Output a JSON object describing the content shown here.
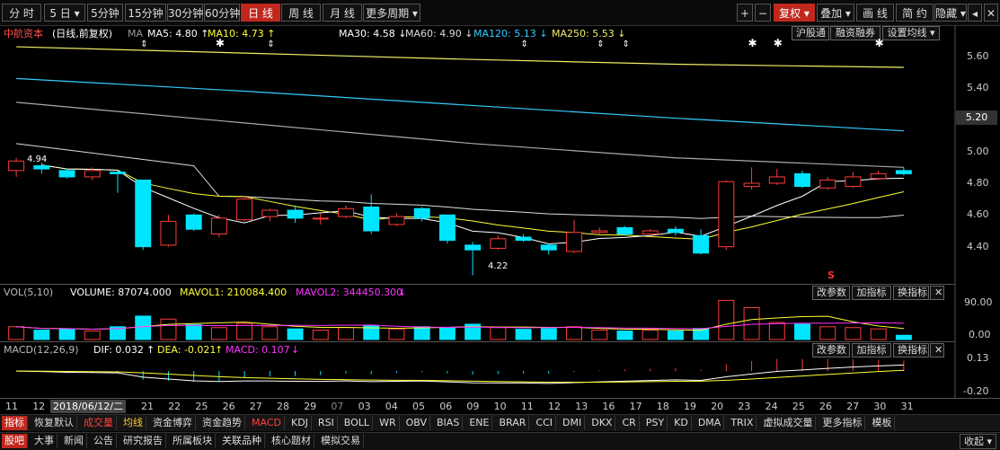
{
  "toolbar": {
    "periods": [
      {
        "label": "分 时",
        "x": 2,
        "w": 44
      },
      {
        "label": "5 日 ▾",
        "x": 49,
        "w": 46
      },
      {
        "label": "5分钟",
        "x": 97,
        "w": 40
      },
      {
        "label": "15分钟",
        "x": 139,
        "w": 46
      },
      {
        "label": "30分钟",
        "x": 186,
        "w": 40
      },
      {
        "label": "60分钟",
        "x": 227,
        "w": 40
      },
      {
        "label": "日 线",
        "x": 268,
        "w": 44,
        "active": true
      },
      {
        "label": "周 线",
        "x": 313,
        "w": 44
      },
      {
        "label": "月 线",
        "x": 359,
        "w": 44
      },
      {
        "label": "更多周期 ▾",
        "x": 404,
        "w": 64
      }
    ],
    "right": [
      {
        "label": "+",
        "x": 820,
        "w": 18
      },
      {
        "label": "−",
        "x": 840,
        "w": 18
      },
      {
        "label": "复权 ▾",
        "x": 861,
        "w": 46,
        "active": true
      },
      {
        "label": "叠加 ▾",
        "x": 909,
        "w": 42
      },
      {
        "label": "画 线",
        "x": 953,
        "w": 42
      },
      {
        "label": "简 约",
        "x": 997,
        "w": 42
      },
      {
        "label": "隐藏 ▾",
        "x": 1040,
        "w": 36
      },
      {
        "label": "◂",
        "x": 1077,
        "w": 16
      },
      {
        "label": "✕",
        "x": 1095,
        "w": 16
      }
    ]
  },
  "ma_bar": {
    "stock": "中航资本",
    "mode": "(日线,前复权)",
    "ma_label": "MA",
    "items": [
      {
        "text": "MA5: 4.80",
        "arrow": "↑",
        "color": "#ffffff",
        "x": 164
      },
      {
        "text": "MA10: 4.73",
        "arrow": "↑",
        "color": "#ffff33",
        "x": 231
      },
      {
        "text": "MA30: 4.58",
        "arrow": "↓",
        "color": "#ffffff",
        "x": 377
      },
      {
        "text": "MA60: 4.90",
        "arrow": "↓",
        "color": "#dddddd",
        "x": 451
      },
      {
        "text": "MA120: 5.13",
        "arrow": "↓",
        "color": "#33ccff",
        "x": 527
      },
      {
        "text": "MA250: 5.53",
        "arrow": "↓",
        "color": "#eeee66",
        "x": 614
      }
    ],
    "buttons": [
      {
        "label": "沪股通",
        "x": 881,
        "w": 42
      },
      {
        "label": "融资融券",
        "x": 924,
        "w": 56
      },
      {
        "label": "设置均线 ▾",
        "x": 982,
        "w": 64
      }
    ]
  },
  "price_axis": {
    "ticks": [
      "5.60",
      "5.40",
      "5.20",
      "5.00",
      "4.80",
      "4.60",
      "4.40"
    ],
    "current": "5.20",
    "max_label": "4.94",
    "min_label": "4.22",
    "s_marker": "S"
  },
  "volume_bar": {
    "label": "VOL(5,10)",
    "volume": "VOLUME: 87074.000",
    "mavol1": "MAVOL1: 210084.400",
    "mavol2": "MAVOL2: 344450.300",
    "arrow": "↓",
    "buttons": [
      "改参数",
      "加指标",
      "换指标",
      "✕"
    ],
    "ticks": [
      "90.00",
      "0.00"
    ]
  },
  "macd_bar": {
    "label": "MACD(12,26,9)",
    "dif": "DIF: 0.032",
    "dif_arrow": "↑",
    "dea": "DEA: -0.021",
    "dea_arrow": "↑",
    "macd": "MACD: 0.107",
    "macd_arrow": "↓",
    "buttons": [
      "改参数",
      "加指标",
      "换指标",
      "✕"
    ],
    "ticks": [
      "0.13",
      "-0.20"
    ]
  },
  "date_axis": {
    "dates": [
      "11",
      "12",
      "15",
      "19",
      "20",
      "21",
      "22",
      "25",
      "26",
      "27",
      "28",
      "29",
      "07",
      "03",
      "04",
      "05",
      "06",
      "09",
      "10",
      "11",
      "12",
      "13",
      "16",
      "17",
      "18",
      "19",
      "20",
      "23",
      "24",
      "25",
      "26",
      "27",
      "30",
      "31"
    ],
    "cursor_date": "2018/06/12/二"
  },
  "tabs1": [
    {
      "label": "指标",
      "style": "active"
    },
    {
      "label": "恢复默认",
      "style": ""
    },
    {
      "label": "成交量",
      "style": "red"
    },
    {
      "label": "均线",
      "style": "gold"
    },
    {
      "label": "资金博弈",
      "style": ""
    },
    {
      "label": "资金趋势",
      "style": ""
    },
    {
      "label": "MACD",
      "style": "red"
    },
    {
      "label": "KDJ",
      "style": ""
    },
    {
      "label": "RSI",
      "style": ""
    },
    {
      "label": "BOLL",
      "style": ""
    },
    {
      "label": "WR",
      "style": ""
    },
    {
      "label": "OBV",
      "style": ""
    },
    {
      "label": "BIAS",
      "style": ""
    },
    {
      "label": "ENE",
      "style": ""
    },
    {
      "label": "BRAR",
      "style": ""
    },
    {
      "label": "CCI",
      "style": ""
    },
    {
      "label": "DMI",
      "style": ""
    },
    {
      "label": "DKX",
      "style": ""
    },
    {
      "label": "CR",
      "style": ""
    },
    {
      "label": "PSY",
      "style": ""
    },
    {
      "label": "KD",
      "style": ""
    },
    {
      "label": "DMA",
      "style": ""
    },
    {
      "label": "TRIX",
      "style": ""
    },
    {
      "label": "虚拟成交量",
      "style": ""
    },
    {
      "label": "更多指标",
      "style": ""
    },
    {
      "label": "模板",
      "style": ""
    }
  ],
  "tabs2": [
    {
      "label": "股吧",
      "style": "active"
    },
    {
      "label": "大事",
      "style": ""
    },
    {
      "label": "新闻",
      "style": ""
    },
    {
      "label": "公告",
      "style": ""
    },
    {
      "label": "研究报告",
      "style": ""
    },
    {
      "label": "所属板块",
      "style": ""
    },
    {
      "label": "关联品种",
      "style": ""
    },
    {
      "label": "核心题材",
      "style": ""
    },
    {
      "label": "模拟交易",
      "style": ""
    }
  ],
  "collapse_label": "收起 ▾",
  "colors": {
    "up": "#ff3b3b",
    "down": "#00e5ff",
    "ma5": "#ffffff",
    "ma10": "#ffff33",
    "ma30": "#dddddd",
    "ma120": "#33ccff",
    "ma250": "#eeee66",
    "dea": "#ffff33",
    "accent": "#c0281e"
  },
  "chart_data": {
    "type": "candlestick",
    "ylim": [
      4.2,
      5.7
    ],
    "candles": [
      {
        "o": 4.88,
        "c": 4.94,
        "h": 4.96,
        "l": 4.84
      },
      {
        "o": 4.91,
        "c": 4.89,
        "h": 4.93,
        "l": 4.86
      },
      {
        "o": 4.88,
        "c": 4.84,
        "h": 4.89,
        "l": 4.83
      },
      {
        "o": 4.84,
        "c": 4.88,
        "h": 4.9,
        "l": 4.82
      },
      {
        "o": 4.87,
        "c": 4.86,
        "h": 4.88,
        "l": 4.74
      },
      {
        "o": 4.82,
        "c": 4.4,
        "h": 4.82,
        "l": 4.38
      },
      {
        "o": 4.41,
        "c": 4.56,
        "h": 4.6,
        "l": 4.4
      },
      {
        "o": 4.6,
        "c": 4.51,
        "h": 4.61,
        "l": 4.5
      },
      {
        "o": 4.48,
        "c": 4.58,
        "h": 4.6,
        "l": 4.46
      },
      {
        "o": 4.57,
        "c": 4.7,
        "h": 4.72,
        "l": 4.56
      },
      {
        "o": 4.59,
        "c": 4.63,
        "h": 4.64,
        "l": 4.56
      },
      {
        "o": 4.63,
        "c": 4.58,
        "h": 4.66,
        "l": 4.55
      },
      {
        "o": 4.58,
        "c": 4.58,
        "h": 4.61,
        "l": 4.54
      },
      {
        "o": 4.59,
        "c": 4.64,
        "h": 4.66,
        "l": 4.58
      },
      {
        "o": 4.65,
        "c": 4.5,
        "h": 4.73,
        "l": 4.48
      },
      {
        "o": 4.54,
        "c": 4.59,
        "h": 4.61,
        "l": 4.53
      },
      {
        "o": 4.64,
        "c": 4.58,
        "h": 4.65,
        "l": 4.56
      },
      {
        "o": 4.6,
        "c": 4.44,
        "h": 4.6,
        "l": 4.42
      },
      {
        "o": 4.41,
        "c": 4.38,
        "h": 4.43,
        "l": 4.22
      },
      {
        "o": 4.39,
        "c": 4.45,
        "h": 4.47,
        "l": 4.38
      },
      {
        "o": 4.46,
        "c": 4.44,
        "h": 4.48,
        "l": 4.43
      },
      {
        "o": 4.41,
        "c": 4.38,
        "h": 4.42,
        "l": 4.35
      },
      {
        "o": 4.37,
        "c": 4.49,
        "h": 4.57,
        "l": 4.36
      },
      {
        "o": 4.49,
        "c": 4.5,
        "h": 4.52,
        "l": 4.48
      },
      {
        "o": 4.52,
        "c": 4.48,
        "h": 4.53,
        "l": 4.47
      },
      {
        "o": 4.48,
        "c": 4.5,
        "h": 4.51,
        "l": 4.48
      },
      {
        "o": 4.51,
        "c": 4.49,
        "h": 4.53,
        "l": 4.47
      },
      {
        "o": 4.47,
        "c": 4.36,
        "h": 4.51,
        "l": 4.35
      },
      {
        "o": 4.4,
        "c": 4.81,
        "h": 4.82,
        "l": 4.38
      },
      {
        "o": 4.78,
        "c": 4.8,
        "h": 4.9,
        "l": 4.76
      },
      {
        "o": 4.8,
        "c": 4.84,
        "h": 4.89,
        "l": 4.79
      },
      {
        "o": 4.86,
        "c": 4.78,
        "h": 4.88,
        "l": 4.77
      },
      {
        "o": 4.77,
        "c": 4.82,
        "h": 4.84,
        "l": 4.76
      },
      {
        "o": 4.78,
        "c": 4.84,
        "h": 4.87,
        "l": 4.77
      },
      {
        "o": 4.83,
        "c": 4.86,
        "h": 4.88,
        "l": 4.82
      },
      {
        "o": 4.88,
        "c": 4.86,
        "h": 4.9,
        "l": 4.85
      }
    ],
    "volumes": [
      30,
      22,
      25,
      20,
      30,
      55,
      48,
      35,
      28,
      38,
      30,
      25,
      22,
      28,
      32,
      25,
      30,
      28,
      36,
      28,
      24,
      26,
      30,
      22,
      20,
      22,
      20,
      26,
      92,
      75,
      40,
      36,
      30,
      28,
      25,
      10
    ],
    "vol_ylim": [
      0,
      95
    ],
    "macd_ylim": [
      -0.22,
      0.14
    ]
  }
}
